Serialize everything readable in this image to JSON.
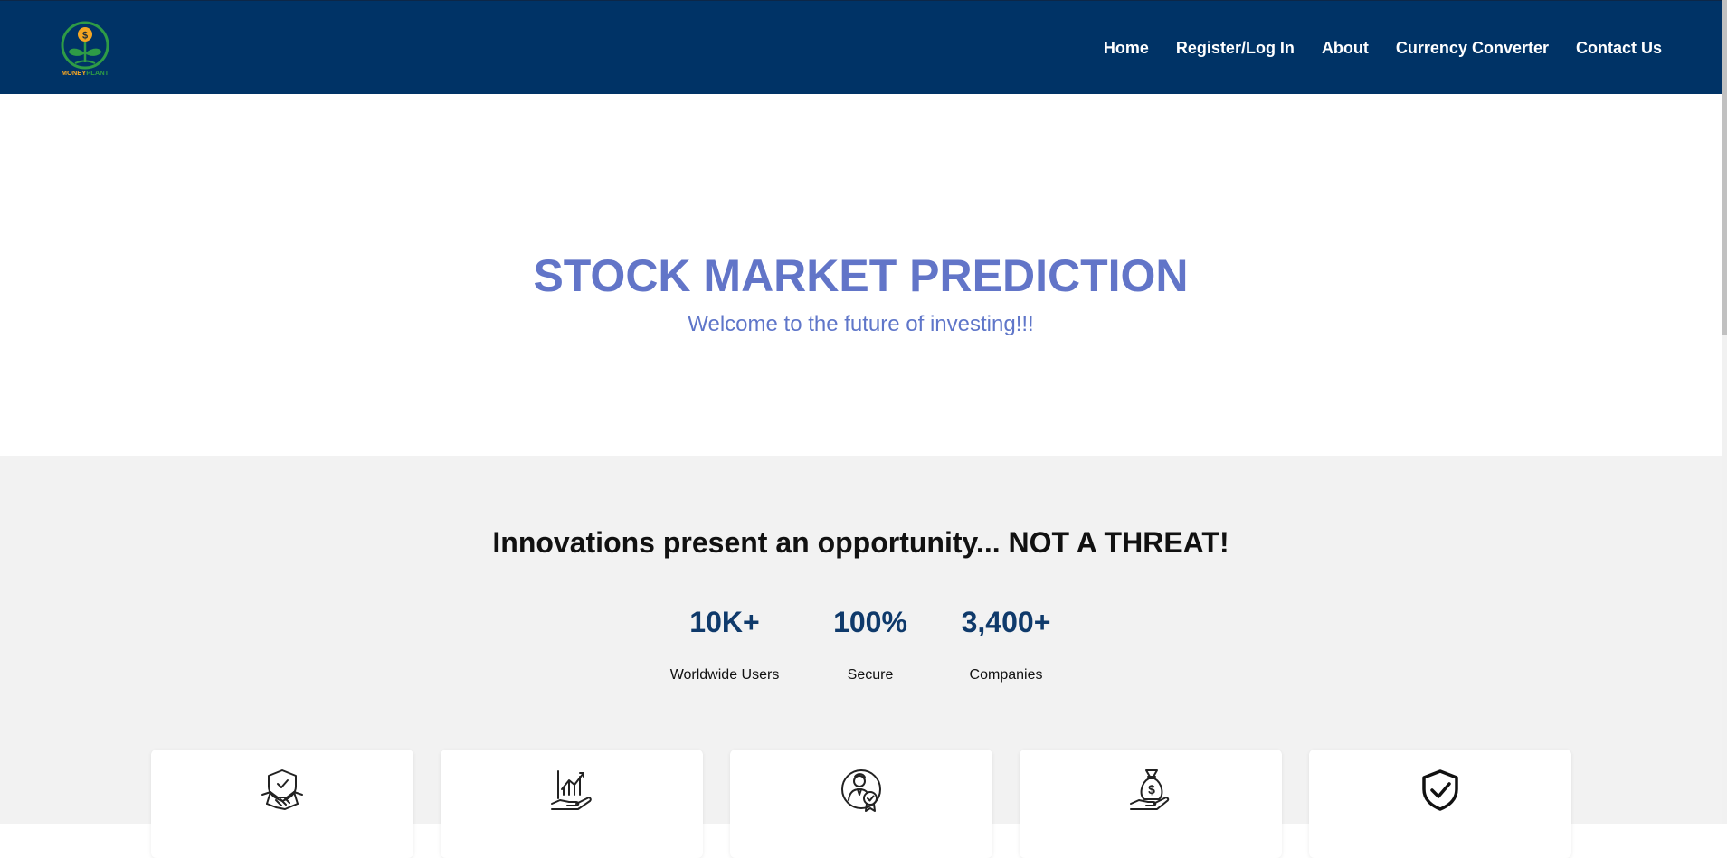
{
  "nav": {
    "logo_text": "MONEYPLANT",
    "links": [
      "Home",
      "Register/Log In",
      "About",
      "Currency Converter",
      "Contact Us"
    ]
  },
  "hero": {
    "title": "STOCK MARKET PREDICTION",
    "subtitle": "Welcome to the future of investing!!!"
  },
  "features": {
    "tagline": "Innovations present an opportunity... NOT A THREAT!",
    "stats": [
      {
        "value": "10K+",
        "label": "Worldwide Users"
      },
      {
        "value": "100%",
        "label": "Secure"
      },
      {
        "value": "3,400+",
        "label": "Companies"
      }
    ],
    "cards": [
      {
        "icon": "handshake-shield-icon"
      },
      {
        "icon": "hand-chart-icon"
      },
      {
        "icon": "certified-advisor-icon"
      },
      {
        "icon": "money-bag-hand-icon"
      },
      {
        "icon": "shield-check-icon"
      }
    ]
  },
  "colors": {
    "navbar": "#003366",
    "hero_text": "#6275c8",
    "stat_number": "#0f3a6b",
    "section_bg": "#f2f2f2"
  }
}
